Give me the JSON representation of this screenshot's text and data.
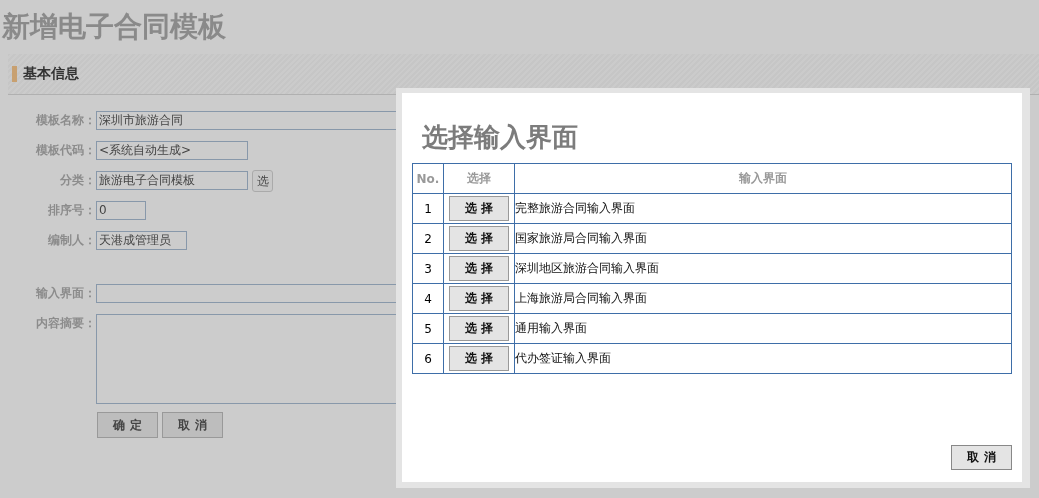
{
  "page": {
    "title": "新增电子合同模板"
  },
  "section": {
    "title": "基本信息"
  },
  "form": {
    "fields": [
      {
        "label": "模板名称：",
        "value": "深圳市旅游合同",
        "kind": "long"
      },
      {
        "label": "模板代码：",
        "value": "<系统自动生成>",
        "kind": "medium"
      },
      {
        "label": "分类：",
        "value": "旅游电子合同模板",
        "kind": "picker",
        "button": "选"
      },
      {
        "label": "排序号：",
        "value": "0",
        "kind": "short"
      },
      {
        "label": "编制人：",
        "value": "天港成管理员",
        "kind": "compact"
      },
      {
        "label": "输入界面：",
        "kind": "long"
      },
      {
        "label": "内容摘要：",
        "kind": "textarea"
      }
    ],
    "buttons": [
      "确 定",
      "取 消"
    ]
  },
  "dialog": {
    "title": "选择输入界面",
    "columns": [
      "No.",
      "选择",
      "输入界面"
    ],
    "rows": [
      {
        "no": "1",
        "button": "选 择",
        "name": "完整旅游合同输入界面"
      },
      {
        "no": "2",
        "button": "选 择",
        "name": "国家旅游局合同输入界面"
      },
      {
        "no": "3",
        "button": "选 择",
        "name": "深圳地区旅游合同输入界面"
      },
      {
        "no": "4",
        "button": "选 择",
        "name": "上海旅游局合同输入界面"
      },
      {
        "no": "5",
        "button": "选 择",
        "name": "通用输入界面"
      },
      {
        "no": "6",
        "button": "选 择",
        "name": "代办签证输入界面"
      }
    ],
    "cancel": "取 消"
  }
}
